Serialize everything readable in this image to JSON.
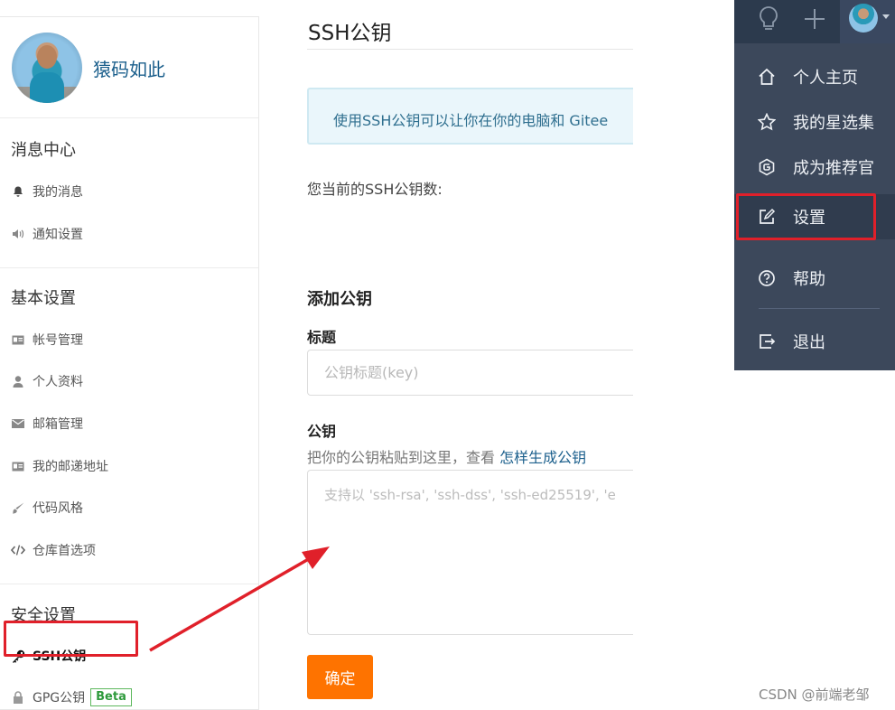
{
  "sidebar": {
    "username": "猿码如此",
    "sections": [
      {
        "title": "消息中心",
        "items": [
          {
            "label": "我的消息",
            "icon": "bell-icon"
          },
          {
            "label": "通知设置",
            "icon": "speaker-icon"
          }
        ]
      },
      {
        "title": "基本设置",
        "items": [
          {
            "label": "帐号管理",
            "icon": "id-card-icon"
          },
          {
            "label": "个人资料",
            "icon": "user-icon"
          },
          {
            "label": "邮箱管理",
            "icon": "envelope-icon"
          },
          {
            "label": "我的邮递地址",
            "icon": "id-card-icon"
          },
          {
            "label": "代码风格",
            "icon": "brush-icon"
          },
          {
            "label": "仓库首选项",
            "icon": "code-icon"
          }
        ]
      },
      {
        "title": "安全设置",
        "items": [
          {
            "label": "SSH公钥",
            "icon": "key-icon",
            "active": true
          },
          {
            "label": "GPG公钥",
            "icon": "lock-icon",
            "badge": "Beta"
          }
        ]
      }
    ]
  },
  "main": {
    "title": "SSH公钥",
    "info_text": "使用SSH公钥可以让你在你的电脑和 Gitee",
    "key_count_label": "您当前的SSH公钥数:",
    "add_title": "添加公钥",
    "title_field": {
      "label": "标题",
      "placeholder": "公钥标题(key)",
      "value": ""
    },
    "key_field": {
      "label": "公钥",
      "hint": "把你的公钥粘贴到这里，查看 ",
      "hint_link": "怎样生成公钥",
      "placeholder": "支持以 'ssh-rsa', 'ssh-dss', 'ssh-ed25519', 'e",
      "value": ""
    },
    "submit_label": "确定"
  },
  "dropdown": {
    "menu": [
      {
        "label": "个人主页",
        "icon": "home-icon"
      },
      {
        "label": "我的星选集",
        "icon": "star-icon"
      },
      {
        "label": "成为推荐官",
        "icon": "gitee-g-icon"
      },
      {
        "label": "设置",
        "icon": "edit-icon",
        "highlighted": true
      },
      {
        "label": "帮助",
        "icon": "question-icon"
      },
      {
        "label": "退出",
        "icon": "logout-icon"
      }
    ]
  },
  "watermark": "CSDN @前端老邹",
  "colors": {
    "accent_orange": "#fe7300",
    "highlight_red": "#e0202a",
    "menu_bg": "#3c485b",
    "link_blue": "#1b5f8c",
    "badge_green": "#2e9a3c"
  }
}
